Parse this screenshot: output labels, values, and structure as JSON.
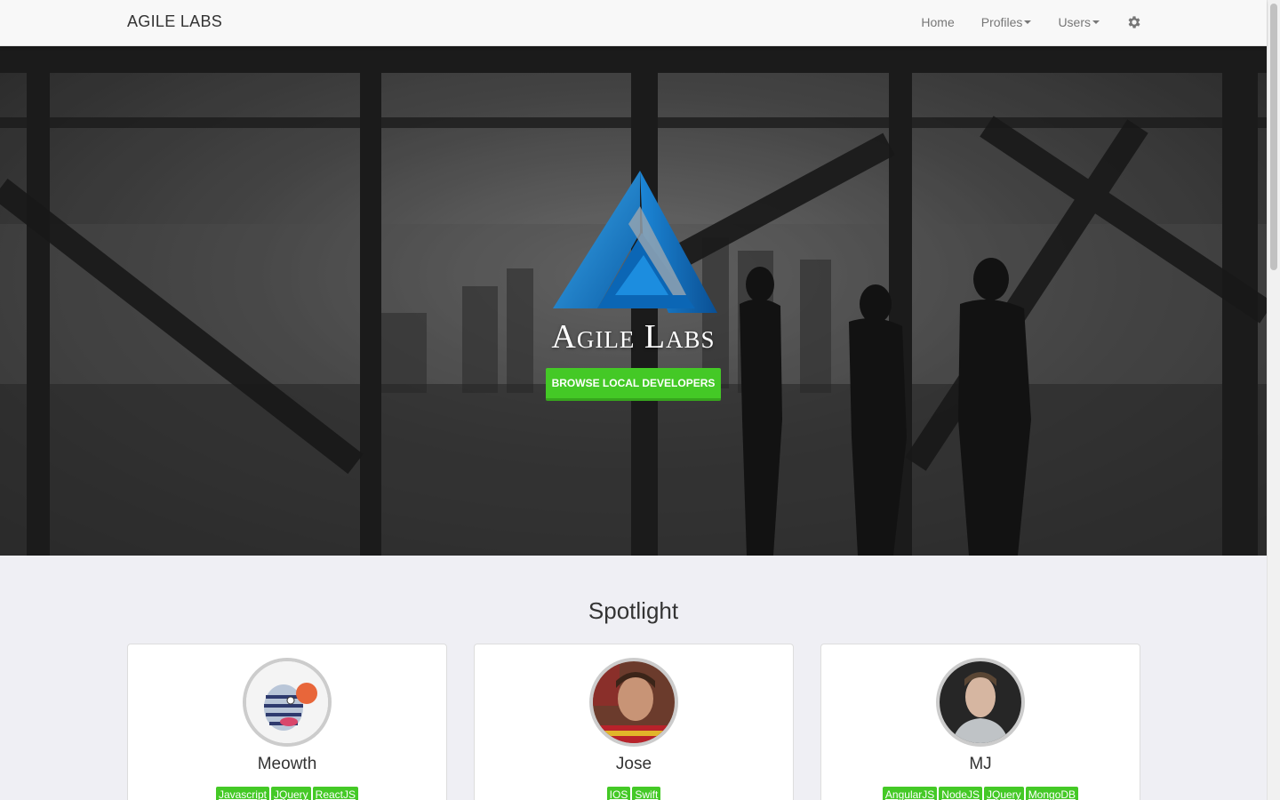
{
  "navbar": {
    "brand": "AGILE LABS",
    "links": [
      {
        "label": "Home",
        "dropdown": false
      },
      {
        "label": "Profiles",
        "dropdown": true
      },
      {
        "label": "Users",
        "dropdown": true
      }
    ],
    "settings_icon": "gear-icon"
  },
  "hero": {
    "logo_icon": "agile-labs-triangle-logo",
    "title": "Agile Labs",
    "cta_label": "BROWSE LOCAL DEVELOPERS",
    "cta_color": "#44c926"
  },
  "spotlight": {
    "heading": "Spotlight",
    "cards": [
      {
        "name": "Meowth",
        "tags": [
          "Javascript",
          "JQuery",
          "ReactJS"
        ]
      },
      {
        "name": "Jose",
        "tags": [
          "IOS",
          "Swift"
        ]
      },
      {
        "name": "MJ",
        "tags": [
          "AngularJS",
          "NodeJS",
          "JQuery",
          "MongoDB"
        ]
      }
    ]
  },
  "colors": {
    "tag": "#44c926",
    "page_background": "#efeff4"
  }
}
